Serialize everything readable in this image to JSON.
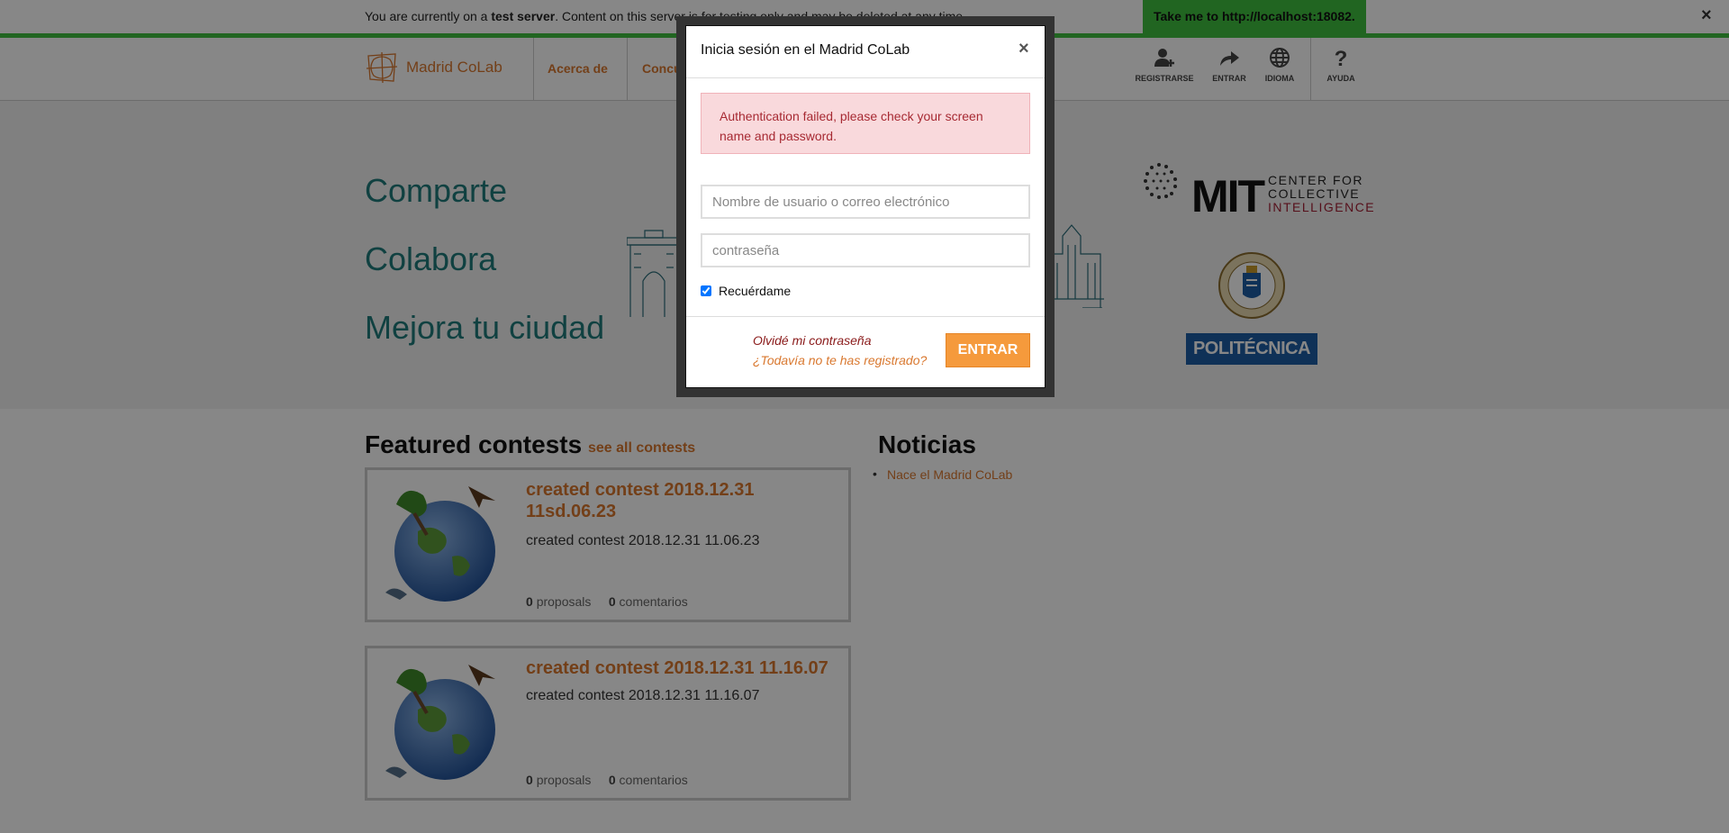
{
  "banner": {
    "text_prefix": "You are currently on a ",
    "text_bold": "test server",
    "text_suffix": ". Content on this server is for testing only and may be deleted at any time.",
    "link_label": "Take me to http://localhost:18082.",
    "close_label": "×"
  },
  "nav": {
    "logo_text": "Madrid CoLab",
    "links": [
      {
        "label": "Acerca de"
      },
      {
        "label": "Concursos"
      }
    ],
    "actions": [
      {
        "label": "REGISTRARSE",
        "icon": "add-user-icon"
      },
      {
        "label": "ENTRAR",
        "icon": "share-arrow-icon"
      },
      {
        "label": "IDIOMA",
        "icon": "globe-icon"
      },
      {
        "label": "AYUDA",
        "icon": "question-icon"
      }
    ]
  },
  "hero": {
    "lines": [
      "Comparte",
      "Colabora",
      "Mejora tu ciudad"
    ],
    "mit_logo": {
      "wordmark": "MIT",
      "line1": "CENTER FOR",
      "line2": "COLLECTIVE",
      "line3": "INTELLIGENCE"
    },
    "upm_logo": {
      "text": "POLITÉCNICA"
    }
  },
  "contests": {
    "title": "Featured contests",
    "see_all": "see all contests",
    "items": [
      {
        "title": "created contest 2018.12.31 11sd.06.23",
        "description": "created contest 2018.12.31 11.06.23",
        "proposals_count": "0",
        "proposals_label": "proposals",
        "comments_count": "0",
        "comments_label": "comentarios"
      },
      {
        "title": "created contest 2018.12.31 11.16.07",
        "description": "created contest 2018.12.31 11.16.07",
        "proposals_count": "0",
        "proposals_label": "proposals",
        "comments_count": "0",
        "comments_label": "comentarios"
      }
    ]
  },
  "news": {
    "title": "Noticias",
    "items": [
      {
        "label": "Nace el Madrid CoLab"
      }
    ]
  },
  "login_modal": {
    "title": "Inicia sesión en el Madrid CoLab",
    "close_label": "×",
    "error": "Authentication failed, please check your screen name and password.",
    "username_placeholder": "Nombre de usuario o correo electrónico",
    "password_placeholder": "contraseña",
    "remember_label": "Recuérdame",
    "remember_checked": true,
    "forgot_label": "Olvidé mi contraseña",
    "register_label": "¿Todavía no te has registrado?",
    "submit_label": "ENTRAR"
  },
  "colors": {
    "accent": "#d9782f",
    "teal": "#1f7b7b",
    "banner_green": "#3fbf3f",
    "button_orange": "#f59a3c",
    "alert_bg": "#f9d9dc"
  }
}
